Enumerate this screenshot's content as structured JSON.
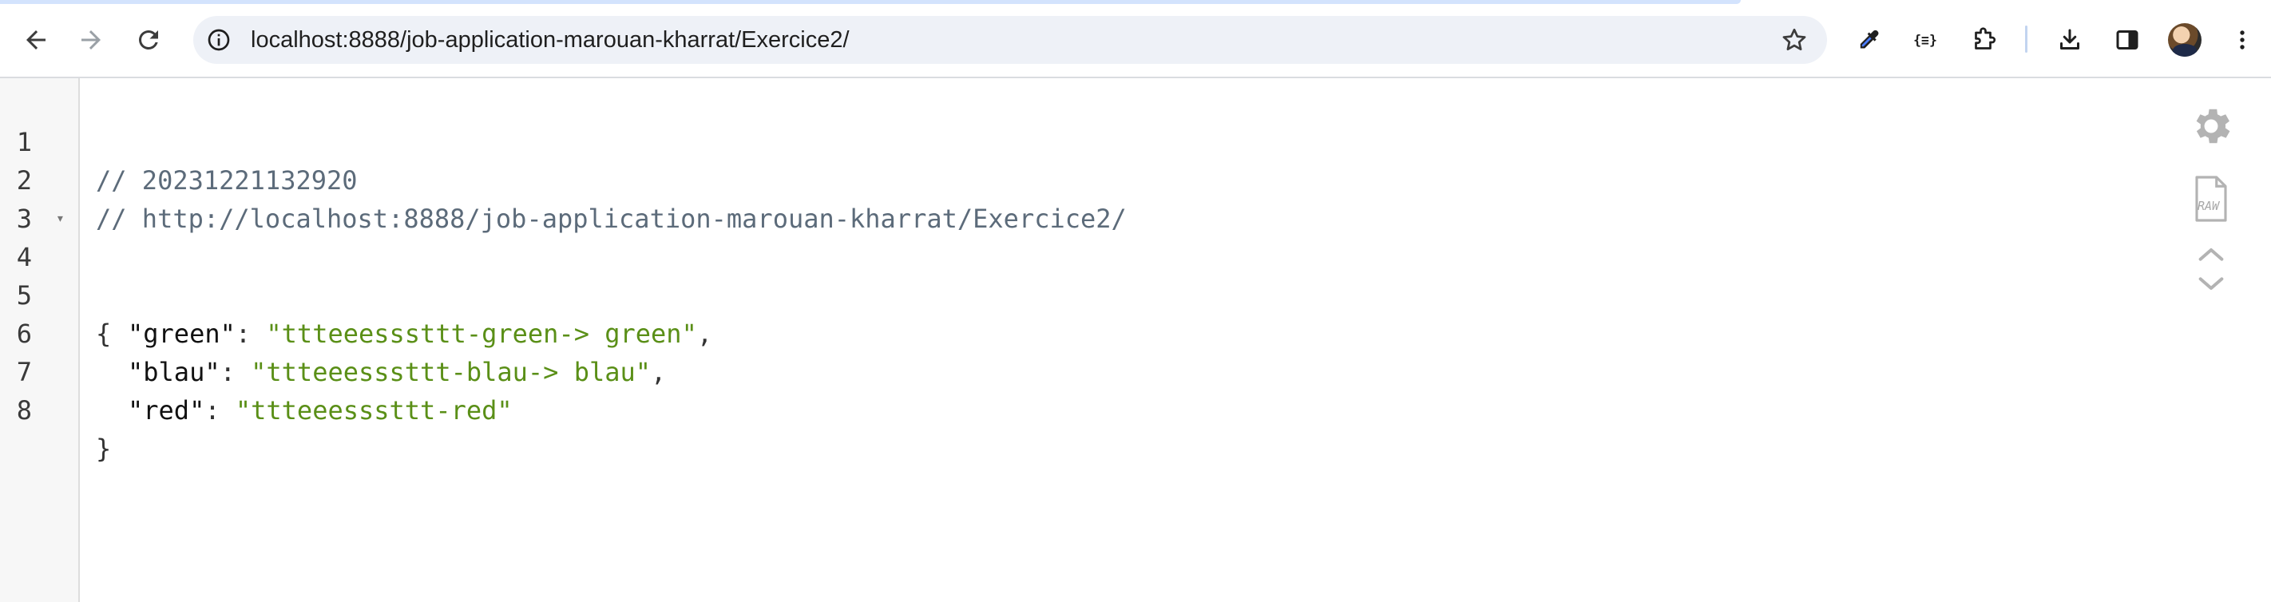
{
  "browser": {
    "url": "localhost:8888/job-application-marouan-kharrat/Exercice2/",
    "icons": {
      "back": "arrow-left-icon",
      "forward": "arrow-right-icon",
      "reload": "reload-icon",
      "site_info": "info-icon",
      "bookmark": "star-icon",
      "eyedropper": "eyedropper-icon",
      "json_viewer": "braces-icon",
      "extensions": "puzzle-icon",
      "downloads": "download-icon",
      "side_panel": "side-panel-icon",
      "profile": "avatar",
      "menu": "kebab-menu-icon"
    }
  },
  "viewer": {
    "lines": [
      {
        "num": "1",
        "comment": "// 20231221132920"
      },
      {
        "num": "2",
        "comment": "// http://localhost:8888/job-application-marouan-kharrat/Exercice2/"
      },
      {
        "num": "3"
      },
      {
        "num": "4",
        "open": "{",
        "fold": "▾"
      },
      {
        "num": "5",
        "key": "\"green\"",
        "colon": ": ",
        "value": "\"ttteeesssttt-green-> green\"",
        "comma": ","
      },
      {
        "num": "6",
        "key": "\"blau\"",
        "colon": ": ",
        "value": "\"ttteeesssttt-blau-> blau\"",
        "comma": ","
      },
      {
        "num": "7",
        "key": "\"red\"",
        "colon": ": ",
        "value": "\"ttteeesssttt-red\""
      },
      {
        "num": "8",
        "close": "}"
      }
    ],
    "tools": {
      "settings": "gear-icon",
      "raw": "raw-file-icon",
      "raw_label": "RAW",
      "collapse": "chevron-up-icon",
      "expand": "chevron-down-icon"
    }
  },
  "colors": {
    "string": "#5a8f17",
    "comment": "#5c6b7a",
    "omnibox_bg": "#eef1f7"
  }
}
